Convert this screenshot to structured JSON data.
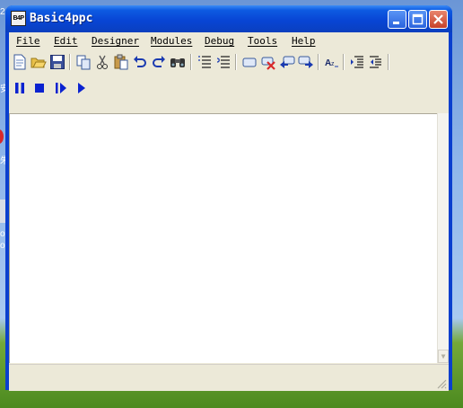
{
  "window": {
    "title": "Basic4ppc",
    "app_icon_text": "B4P",
    "icon_names": {
      "minimize": "minimize-icon",
      "maximize": "maximize-icon",
      "close": "close-icon"
    }
  },
  "menubar": {
    "items": [
      "File",
      "Edit",
      "Designer",
      "Modules",
      "Debug",
      "Tools",
      "Help"
    ]
  },
  "toolbar": {
    "icons": [
      "new-file-icon",
      "open-folder-icon",
      "save-icon",
      "copy-icon",
      "cut-icon",
      "paste-icon",
      "undo-icon",
      "redo-icon",
      "find-icon",
      "comment-lines-icon",
      "uncomment-lines-icon",
      "bookmark-icon",
      "clear-bookmarks-icon",
      "previous-bookmark-icon",
      "next-bookmark-icon",
      "font-size-icon",
      "indent-icon",
      "outdent-icon"
    ]
  },
  "debug_toolbar": {
    "icons": [
      "pause-icon",
      "stop-icon",
      "step-icon",
      "run-icon"
    ]
  },
  "desktop": {
    "fragments": [
      "2",
      "安",
      "朱",
      "or",
      "or"
    ]
  },
  "colors": {
    "titlebar": "#0845d5",
    "face": "#ece9d8",
    "editor_bg": "#ffffff",
    "debug_blue": "#0a22d0"
  }
}
